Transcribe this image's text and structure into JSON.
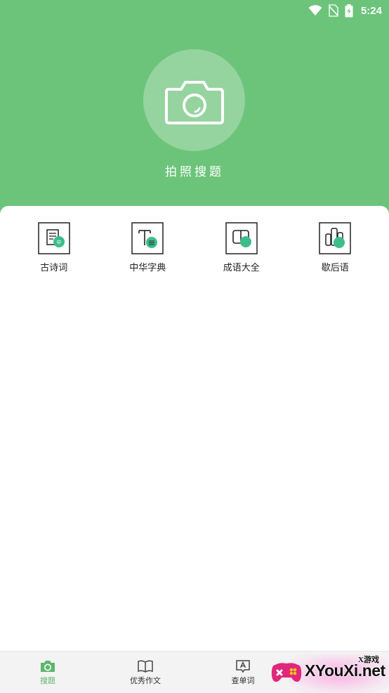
{
  "status_bar": {
    "time": "5:24",
    "icons": [
      "wifi-icon",
      "no-sim-icon",
      "battery-charging-icon"
    ]
  },
  "header": {
    "camera_icon": "camera-icon",
    "camera_label": "拍照搜题",
    "background_color": "#6cc47a"
  },
  "features": [
    {
      "label": "古诗词",
      "icon": "poem-icon"
    },
    {
      "label": "中华字典",
      "icon": "dictionary-icon"
    },
    {
      "label": "成语大全",
      "icon": "idiom-icon"
    },
    {
      "label": "歇后语",
      "icon": "saying-icon"
    }
  ],
  "bottom_nav": {
    "items": [
      {
        "label": "搜题",
        "icon": "camera-search-icon",
        "active": true
      },
      {
        "label": "优秀作文",
        "icon": "book-icon",
        "active": false
      },
      {
        "label": "查单词",
        "icon": "word-lookup-icon",
        "active": false
      }
    ],
    "active_color": "#5fb56e"
  },
  "watermark": {
    "text": "XYouXi.net",
    "small_text": "X游戏"
  }
}
